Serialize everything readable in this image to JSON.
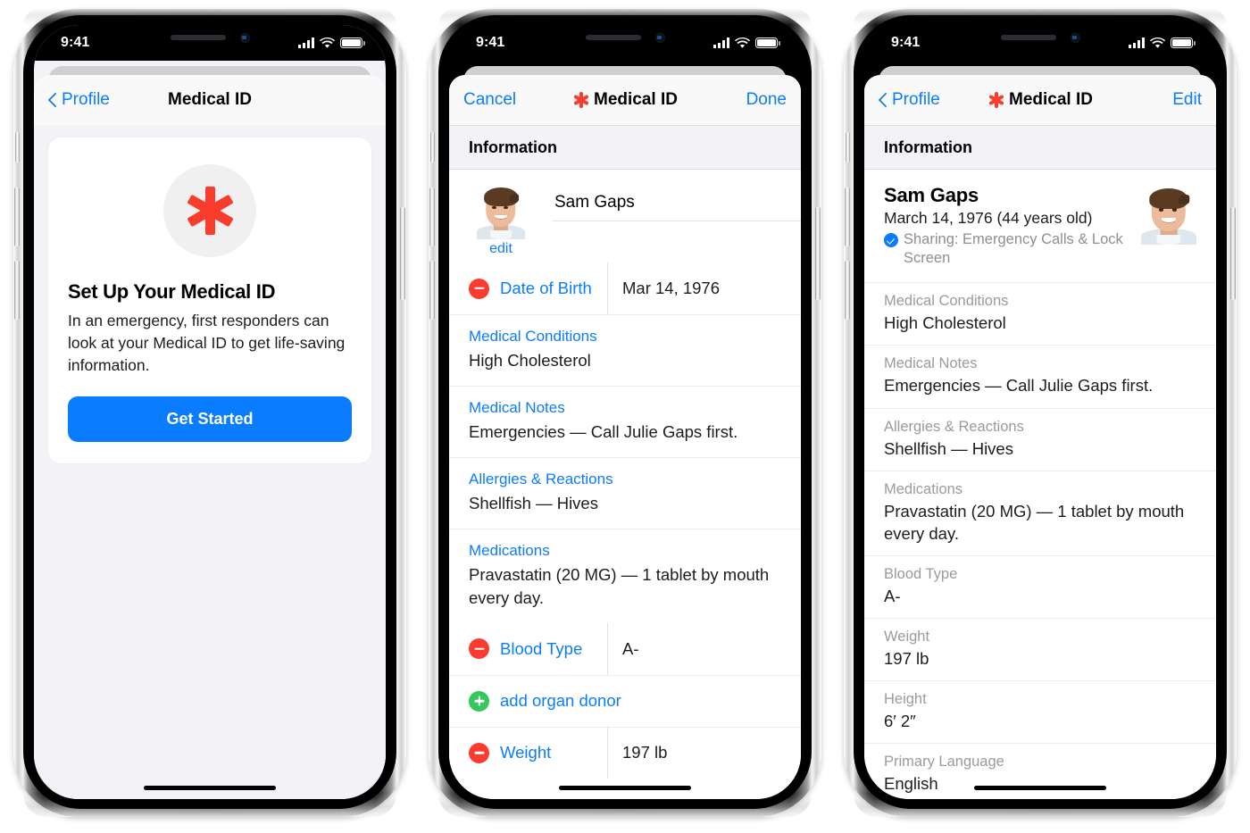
{
  "status_bar": {
    "time": "9:41",
    "icons": [
      "cellular-icon",
      "wifi-icon",
      "battery-icon"
    ]
  },
  "colors": {
    "accent_blue": "#0a7cff",
    "medical_red": "#fa3c2d",
    "delete_red": "#fa3b30",
    "add_green": "#34c759",
    "gray_label": "#9a9aa0",
    "sheet_bg": "#f2f2f7"
  },
  "phones": [
    {
      "id": "setup",
      "nav": {
        "back_label": "Profile",
        "title": "Medical ID",
        "has_title_icon": false
      },
      "intro": {
        "badge_icon": "medical-asterisk-icon",
        "title": "Set Up Your Medical ID",
        "body": "In an emergency, first responders can look at your Medical ID to get life-saving information.",
        "button_label": "Get Started"
      }
    },
    {
      "id": "edit",
      "nav": {
        "cancel_label": "Cancel",
        "title": "Medical ID",
        "done_label": "Done",
        "has_title_icon": true
      },
      "section_header": "Information",
      "person": {
        "avatar_edit_label": "edit",
        "name": "Sam Gaps"
      },
      "rows": [
        {
          "type": "field",
          "control": "minus",
          "label": "Date of Birth",
          "value": "Mar 14, 1976"
        },
        {
          "type": "block",
          "label": "Medical Conditions",
          "value": "High Cholesterol"
        },
        {
          "type": "block",
          "label": "Medical Notes",
          "value": "Emergencies — Call Julie Gaps first."
        },
        {
          "type": "block",
          "label": "Allergies & Reactions",
          "value": "Shellfish — Hives"
        },
        {
          "type": "block",
          "label": "Medications",
          "value": "Pravastatin (20 MG) — 1 tablet by mouth every day."
        },
        {
          "type": "field",
          "control": "minus",
          "label": "Blood Type",
          "value": "A-"
        },
        {
          "type": "action",
          "control": "plus",
          "label": "add organ donor"
        },
        {
          "type": "field",
          "control": "minus",
          "label": "Weight",
          "value": "197 lb"
        }
      ]
    },
    {
      "id": "view",
      "nav": {
        "back_label": "Profile",
        "title": "Medical ID",
        "edit_label": "Edit",
        "has_title_icon": true
      },
      "section_header": "Information",
      "hero": {
        "name": "Sam Gaps",
        "dob": "March 14, 1976 (44 years old)",
        "sharing": "Sharing: Emergency Calls & Lock Screen",
        "sharing_icon": "check-badge-icon"
      },
      "rows": [
        {
          "label": "Medical Conditions",
          "value": "High Cholesterol"
        },
        {
          "label": "Medical Notes",
          "value": "Emergencies — Call Julie Gaps first."
        },
        {
          "label": "Allergies & Reactions",
          "value": "Shellfish — Hives"
        },
        {
          "label": "Medications",
          "value": "Pravastatin (20 MG) — 1 tablet by mouth every day."
        },
        {
          "label": "Blood Type",
          "value": "A-"
        },
        {
          "label": "Weight",
          "value": "197 lb"
        },
        {
          "label": "Height",
          "value": "6′ 2″"
        },
        {
          "label": "Primary Language",
          "value": "English"
        }
      ]
    }
  ]
}
